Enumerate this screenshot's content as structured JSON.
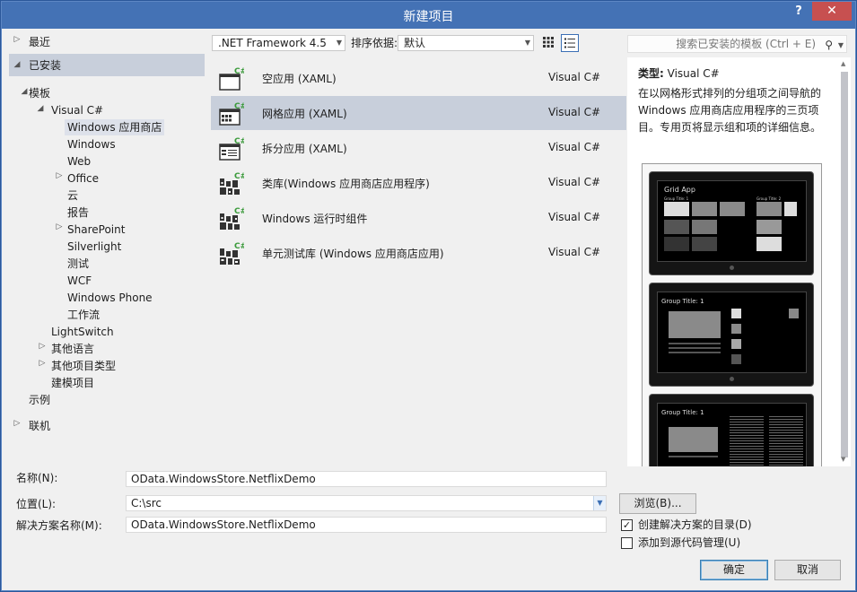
{
  "window": {
    "title": "新建项目",
    "help": "?",
    "close": "✕"
  },
  "tree": {
    "recent": "最近",
    "installed": "已安装",
    "templates": "模板",
    "visual_csharp": "Visual C#",
    "store": "Windows 应用商店",
    "windows": "Windows",
    "web": "Web",
    "office": "Office",
    "cloud": "云",
    "reporting": "报告",
    "sharepoint": "SharePoint",
    "silverlight": "Silverlight",
    "test": "测试",
    "wcf": "WCF",
    "windows_phone": "Windows Phone",
    "workflow": "工作流",
    "lightswitch": "LightSwitch",
    "other_languages": "其他语言",
    "other_project_types": "其他项目类型",
    "modeling": "建模项目",
    "samples": "示例",
    "online": "联机"
  },
  "toolbar": {
    "framework": ".NET Framework 4.5",
    "sort_label": "排序依据:",
    "sort_value": "默认",
    "search_placeholder": "搜索已安装的模板 (Ctrl + E)"
  },
  "templates": [
    {
      "name": "空应用 (XAML)",
      "lang": "Visual C#",
      "icon": "blank-app-icon"
    },
    {
      "name": "网格应用 (XAML)",
      "lang": "Visual C#",
      "icon": "grid-app-icon"
    },
    {
      "name": "拆分应用 (XAML)",
      "lang": "Visual C#",
      "icon": "split-app-icon"
    },
    {
      "name": "类库(Windows 应用商店应用程序)",
      "lang": "Visual C#",
      "icon": "class-library-icon"
    },
    {
      "name": "Windows 运行时组件",
      "lang": "Visual C#",
      "icon": "runtime-component-icon"
    },
    {
      "name": "单元测试库 (Windows 应用商店应用)",
      "lang": "Visual C#",
      "icon": "unit-test-library-icon"
    }
  ],
  "selected_template": 1,
  "info": {
    "type_label": "类型:",
    "type_value": "Visual C#",
    "description": "在以网格形式排列的分组项之间导航的 Windows 应用商店应用程序的三页项目。专用页将显示组和项的详细信息。",
    "preview": {
      "grid_title": "Grid App",
      "group_title_a": "Group Title: 1",
      "group_title_b": "Group Title: 2",
      "group_page_title": "Group Title: 1",
      "item_page_title": "Group Title: 1"
    }
  },
  "form": {
    "name_label": "名称(N):",
    "name_value": "OData.WindowsStore.NetflixDemo",
    "location_label": "位置(L):",
    "location_value": "C:\\src",
    "solution_label": "解决方案名称(M):",
    "solution_value": "OData.WindowsStore.NetflixDemo",
    "browse": "浏览(B)...",
    "create_dir_label": "创建解决方案的目录(D)",
    "create_dir_checked": true,
    "source_control_label": "添加到源代码管理(U)",
    "source_control_checked": false,
    "ok": "确定",
    "cancel": "取消"
  },
  "colors": {
    "titlebar": "#4472b5",
    "selection": "#c8cfdb",
    "close": "#c75050",
    "icon_green": "#3a9a3a"
  }
}
